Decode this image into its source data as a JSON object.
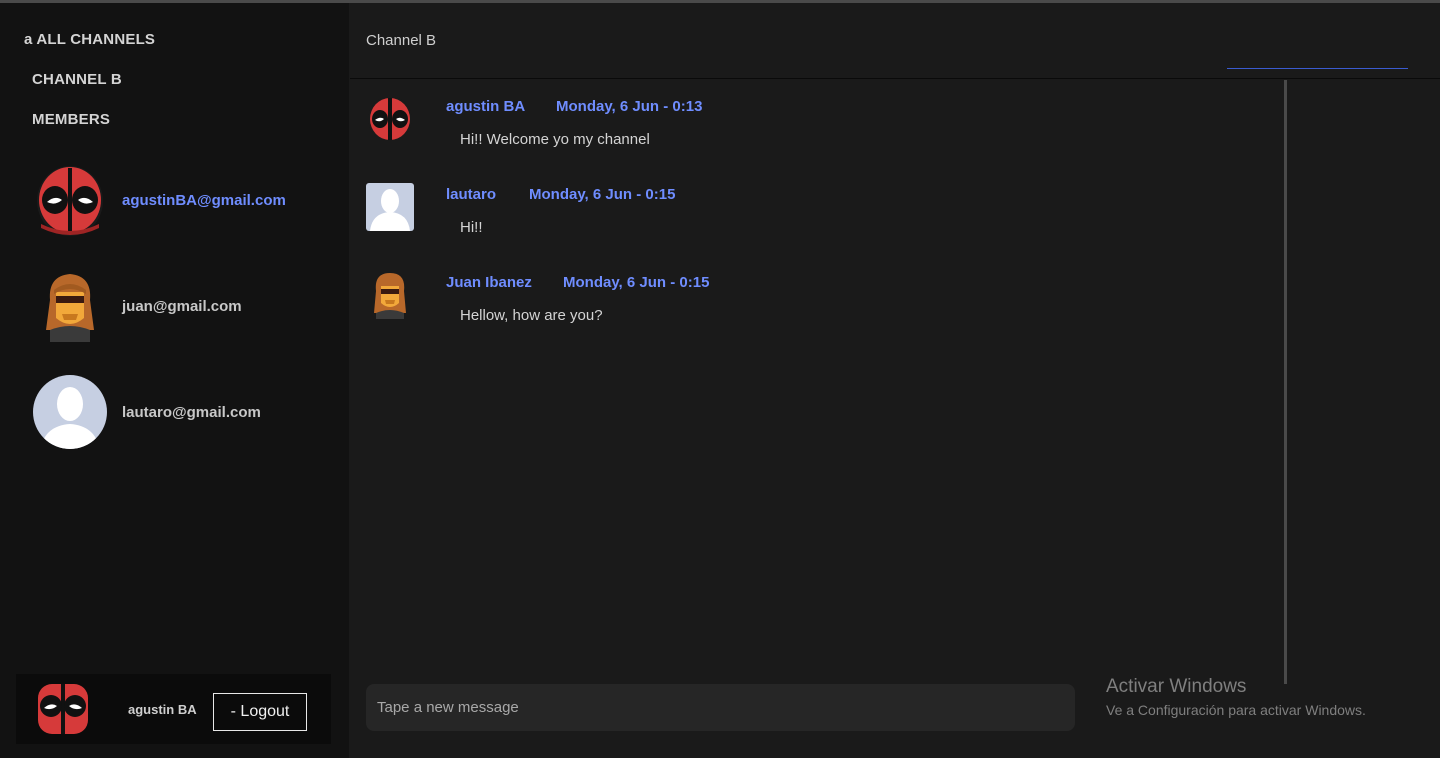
{
  "sidebar": {
    "nav": {
      "all_channels": "a ALL CHANNELS",
      "channel": "CHANNEL B",
      "members": "MEMBERS"
    },
    "members": [
      {
        "email": "agustinBA@gmail.com",
        "avatar": "deadpool-avatar",
        "active": true
      },
      {
        "email": "juan@gmail.com",
        "avatar": "long-hair-man-avatar",
        "active": false
      },
      {
        "email": "lautaro@gmail.com",
        "avatar": "default-user-avatar",
        "active": false
      }
    ],
    "current_user": {
      "name": "agustin BA",
      "avatar": "deadpool-avatar",
      "logout_label": "- Logout"
    }
  },
  "channel": {
    "title": "Channel B"
  },
  "messages": [
    {
      "author": "agustin BA",
      "time": "Monday, 6 Jun - 0:13",
      "text": "Hi!! Welcome yo my channel",
      "avatar": "deadpool-avatar"
    },
    {
      "author": "lautaro",
      "time": "Monday, 6 Jun - 0:15",
      "text": "Hi!!",
      "avatar": "default-user-avatar"
    },
    {
      "author": "Juan Ibanez",
      "time": "Monday, 6 Jun - 0:15",
      "text": "Hellow, how are you?",
      "avatar": "long-hair-man-avatar"
    }
  ],
  "composer": {
    "placeholder": "Tape a new message",
    "value": ""
  },
  "watermark": {
    "title": "Activar Windows",
    "subtitle": "Ve a Configuración para activar Windows."
  },
  "colors": {
    "accent": "#6f8dff",
    "sidebar_bg": "#121212",
    "main_bg": "#1a1a1a",
    "input_bg": "#262626"
  }
}
